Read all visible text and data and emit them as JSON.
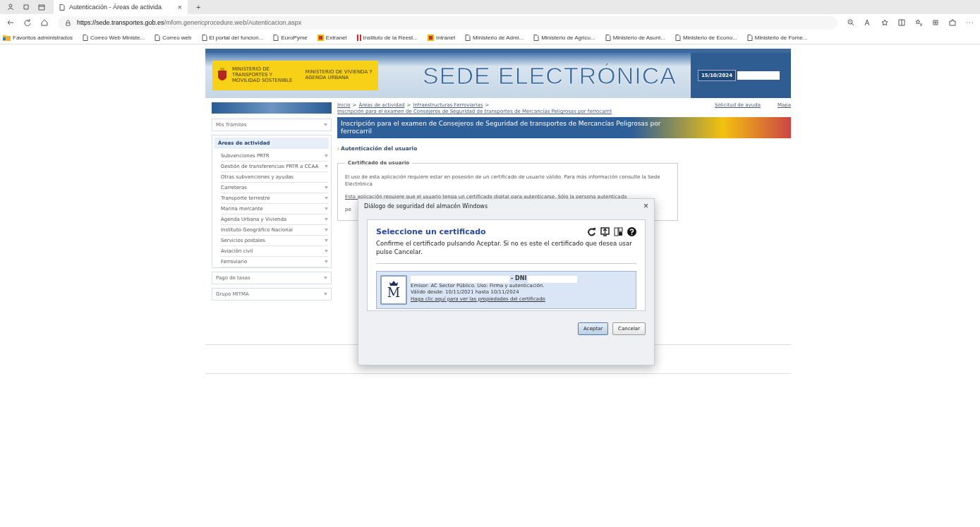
{
  "browser": {
    "tab": {
      "title": "Autenticación - Áreas de activida",
      "close": "×"
    },
    "new_tab": "+",
    "url": {
      "host": "https://sede.transportes.gob.es",
      "path": "/mfom.genericprocedure.web/Autenticacion.aspx"
    },
    "bookmarks": [
      {
        "label": "Favoritos administrados",
        "kind": "folder"
      },
      {
        "label": "Correo Web Ministe...",
        "kind": "page"
      },
      {
        "label": "Correo web",
        "kind": "page"
      },
      {
        "label": "El portal del funcion...",
        "kind": "page"
      },
      {
        "label": "EuroPyme",
        "kind": "page"
      },
      {
        "label": "Extranet",
        "kind": "site"
      },
      {
        "label": "Instituto de la Reest...",
        "kind": "bars"
      },
      {
        "label": "Intranet",
        "kind": "site"
      },
      {
        "label": "Ministerio de Admi...",
        "kind": "page"
      },
      {
        "label": "Ministerio de Agricu...",
        "kind": "page"
      },
      {
        "label": "Ministerio de Asunt...",
        "kind": "page"
      },
      {
        "label": "Ministerio de Econo...",
        "kind": "page"
      },
      {
        "label": "Ministerio de Fome...",
        "kind": "page"
      }
    ]
  },
  "header": {
    "ministries": [
      "MINISTERIO DE TRANSPORTES Y MOVILIDAD SOSTENIBLE",
      "MINISTERIO DE VIVIENDA Y AGENDA URBANA"
    ],
    "banner": "SEDE ELECTRÓNICA",
    "date": "15/10/2024"
  },
  "breadcrumb": [
    "Inicio",
    "Áreas de actividad",
    "Infraestructuras Ferroviarias",
    "Inscripción para el examen de Consejeros de Seguridad de transportes de Mercancías Peligrosas por ferrocarril"
  ],
  "breadcrumb_separator": ">",
  "links": {
    "help": "Solicitud de ayuda",
    "map": "Mapa"
  },
  "page_title": "Inscripción para el examen de Consejeros de Seguridad de transportes de Mercancías Peligrosas por ferrocarril",
  "sidebar": [
    {
      "label": "Mis Trámites",
      "expanded": false
    },
    {
      "label": "Áreas de actividad",
      "expanded": true,
      "items": [
        {
          "label": "Subvenciones PRTR",
          "has_submenu": true
        },
        {
          "label": "Gestión de transferencias PRTR a CCAA",
          "has_submenu": true
        },
        {
          "label": "Otras subvenciones y ayudas",
          "has_submenu": false
        },
        {
          "label": "Carreteras",
          "has_submenu": true
        },
        {
          "label": "Transporte terrestre",
          "has_submenu": true
        },
        {
          "label": "Marina mercante",
          "has_submenu": true
        },
        {
          "label": "Agenda Urbana y Vivienda",
          "has_submenu": true
        },
        {
          "label": "Instituto Geográfico Nacional",
          "has_submenu": true
        },
        {
          "label": "Servicios postales",
          "has_submenu": true
        },
        {
          "label": "Aviación civil",
          "has_submenu": true
        },
        {
          "label": "Ferroviario",
          "has_submenu": true
        }
      ]
    },
    {
      "label": "Pago de tasas",
      "expanded": false
    },
    {
      "label": "Grupo MITMA",
      "expanded": false
    }
  ],
  "section_marker": "›",
  "section_title": "Autenticación del usuario",
  "fieldset": {
    "legend": "Certificado de usuario",
    "paragraphs": [
      "El uso de esta aplicación requiere estar en posesión de un certificado de usuario válido. Para más información consulte la Sede Electrónica",
      "Esta aplicación requiere que el usuario tenga un certificado digital para autenticarse. Sólo la persona autenticada",
      "pe"
    ]
  },
  "dialog": {
    "title": "Diálogo de seguridad del almacén Windows",
    "close": "×",
    "heading": "Seleccione un certificado",
    "message": "Confirme el certificado pulsando Aceptar. Si no es este el certificado que desea usar pulse Cancelar.",
    "certificates": [
      {
        "selected": true,
        "logo_letter": "M",
        "name": "- DNI",
        "issuer": "Emisor: AC Sector Público. Uso: Firma y autenticación.",
        "validity": "Válido desde: 10/11/2021 hasta 10/11/2024",
        "link": "Haga clic aquí para ver las propiedades del certificado"
      }
    ],
    "buttons": [
      {
        "label": "Aceptar",
        "default": true
      },
      {
        "label": "Cancelar",
        "default": false
      }
    ]
  }
}
